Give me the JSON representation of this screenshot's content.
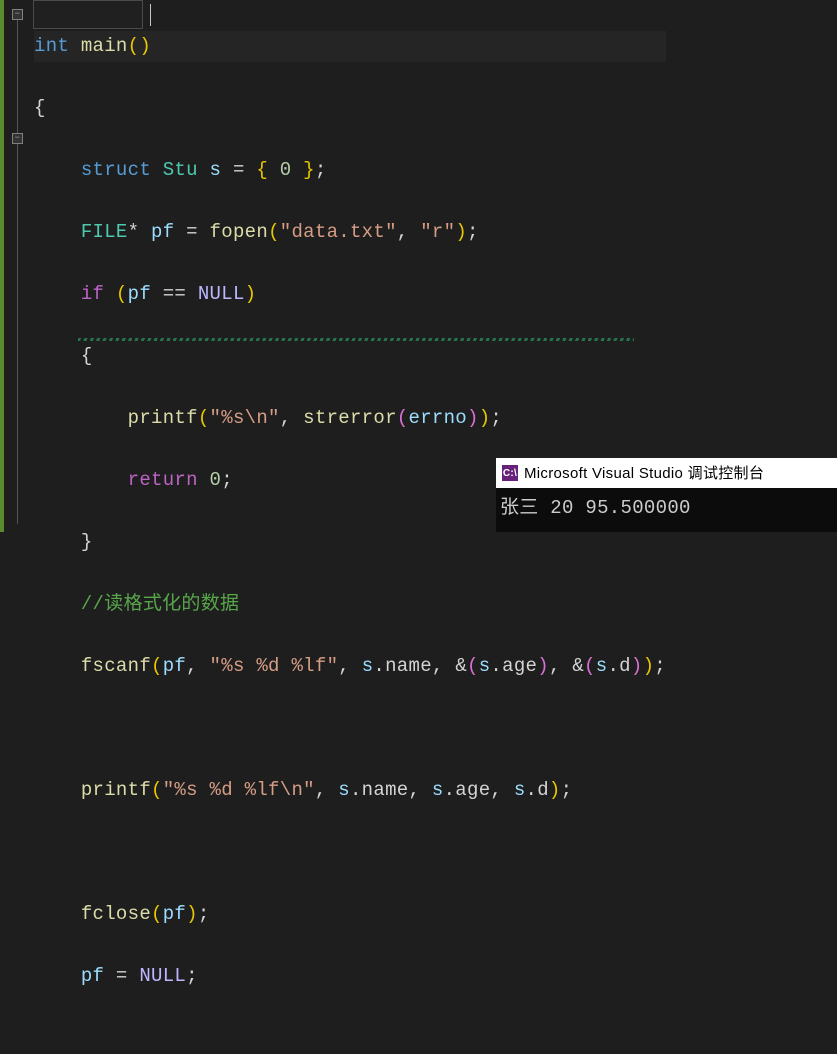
{
  "code": {
    "t_int": "int",
    "t_main": "main",
    "t_struct": "struct",
    "t_Stu": "Stu",
    "t_s": "s",
    "t_zero": "0",
    "t_FILE": "FILE",
    "t_pf": "pf",
    "t_fopen": "fopen",
    "s_data": "\"data.txt\"",
    "s_r": "\"r\"",
    "t_if": "if",
    "t_eq": "==",
    "t_NULL": "NULL",
    "t_printf": "printf",
    "s_errfmt": "\"%s\\n\"",
    "t_strerror": "strerror",
    "t_errno": "errno",
    "t_return": "return",
    "t_ret0": "0",
    "cmt_read": "//读格式化的数据",
    "t_fscanf": "fscanf",
    "s_scanfmt": "\"%s %d %lf\"",
    "t_name": "name",
    "t_age": "age",
    "t_d": "d",
    "s_outfmt": "\"%s %d %lf\\n\"",
    "t_fclose": "fclose"
  },
  "console": {
    "title": "Microsoft Visual Studio 调试控制台",
    "output": "张三 20 95.500000"
  }
}
